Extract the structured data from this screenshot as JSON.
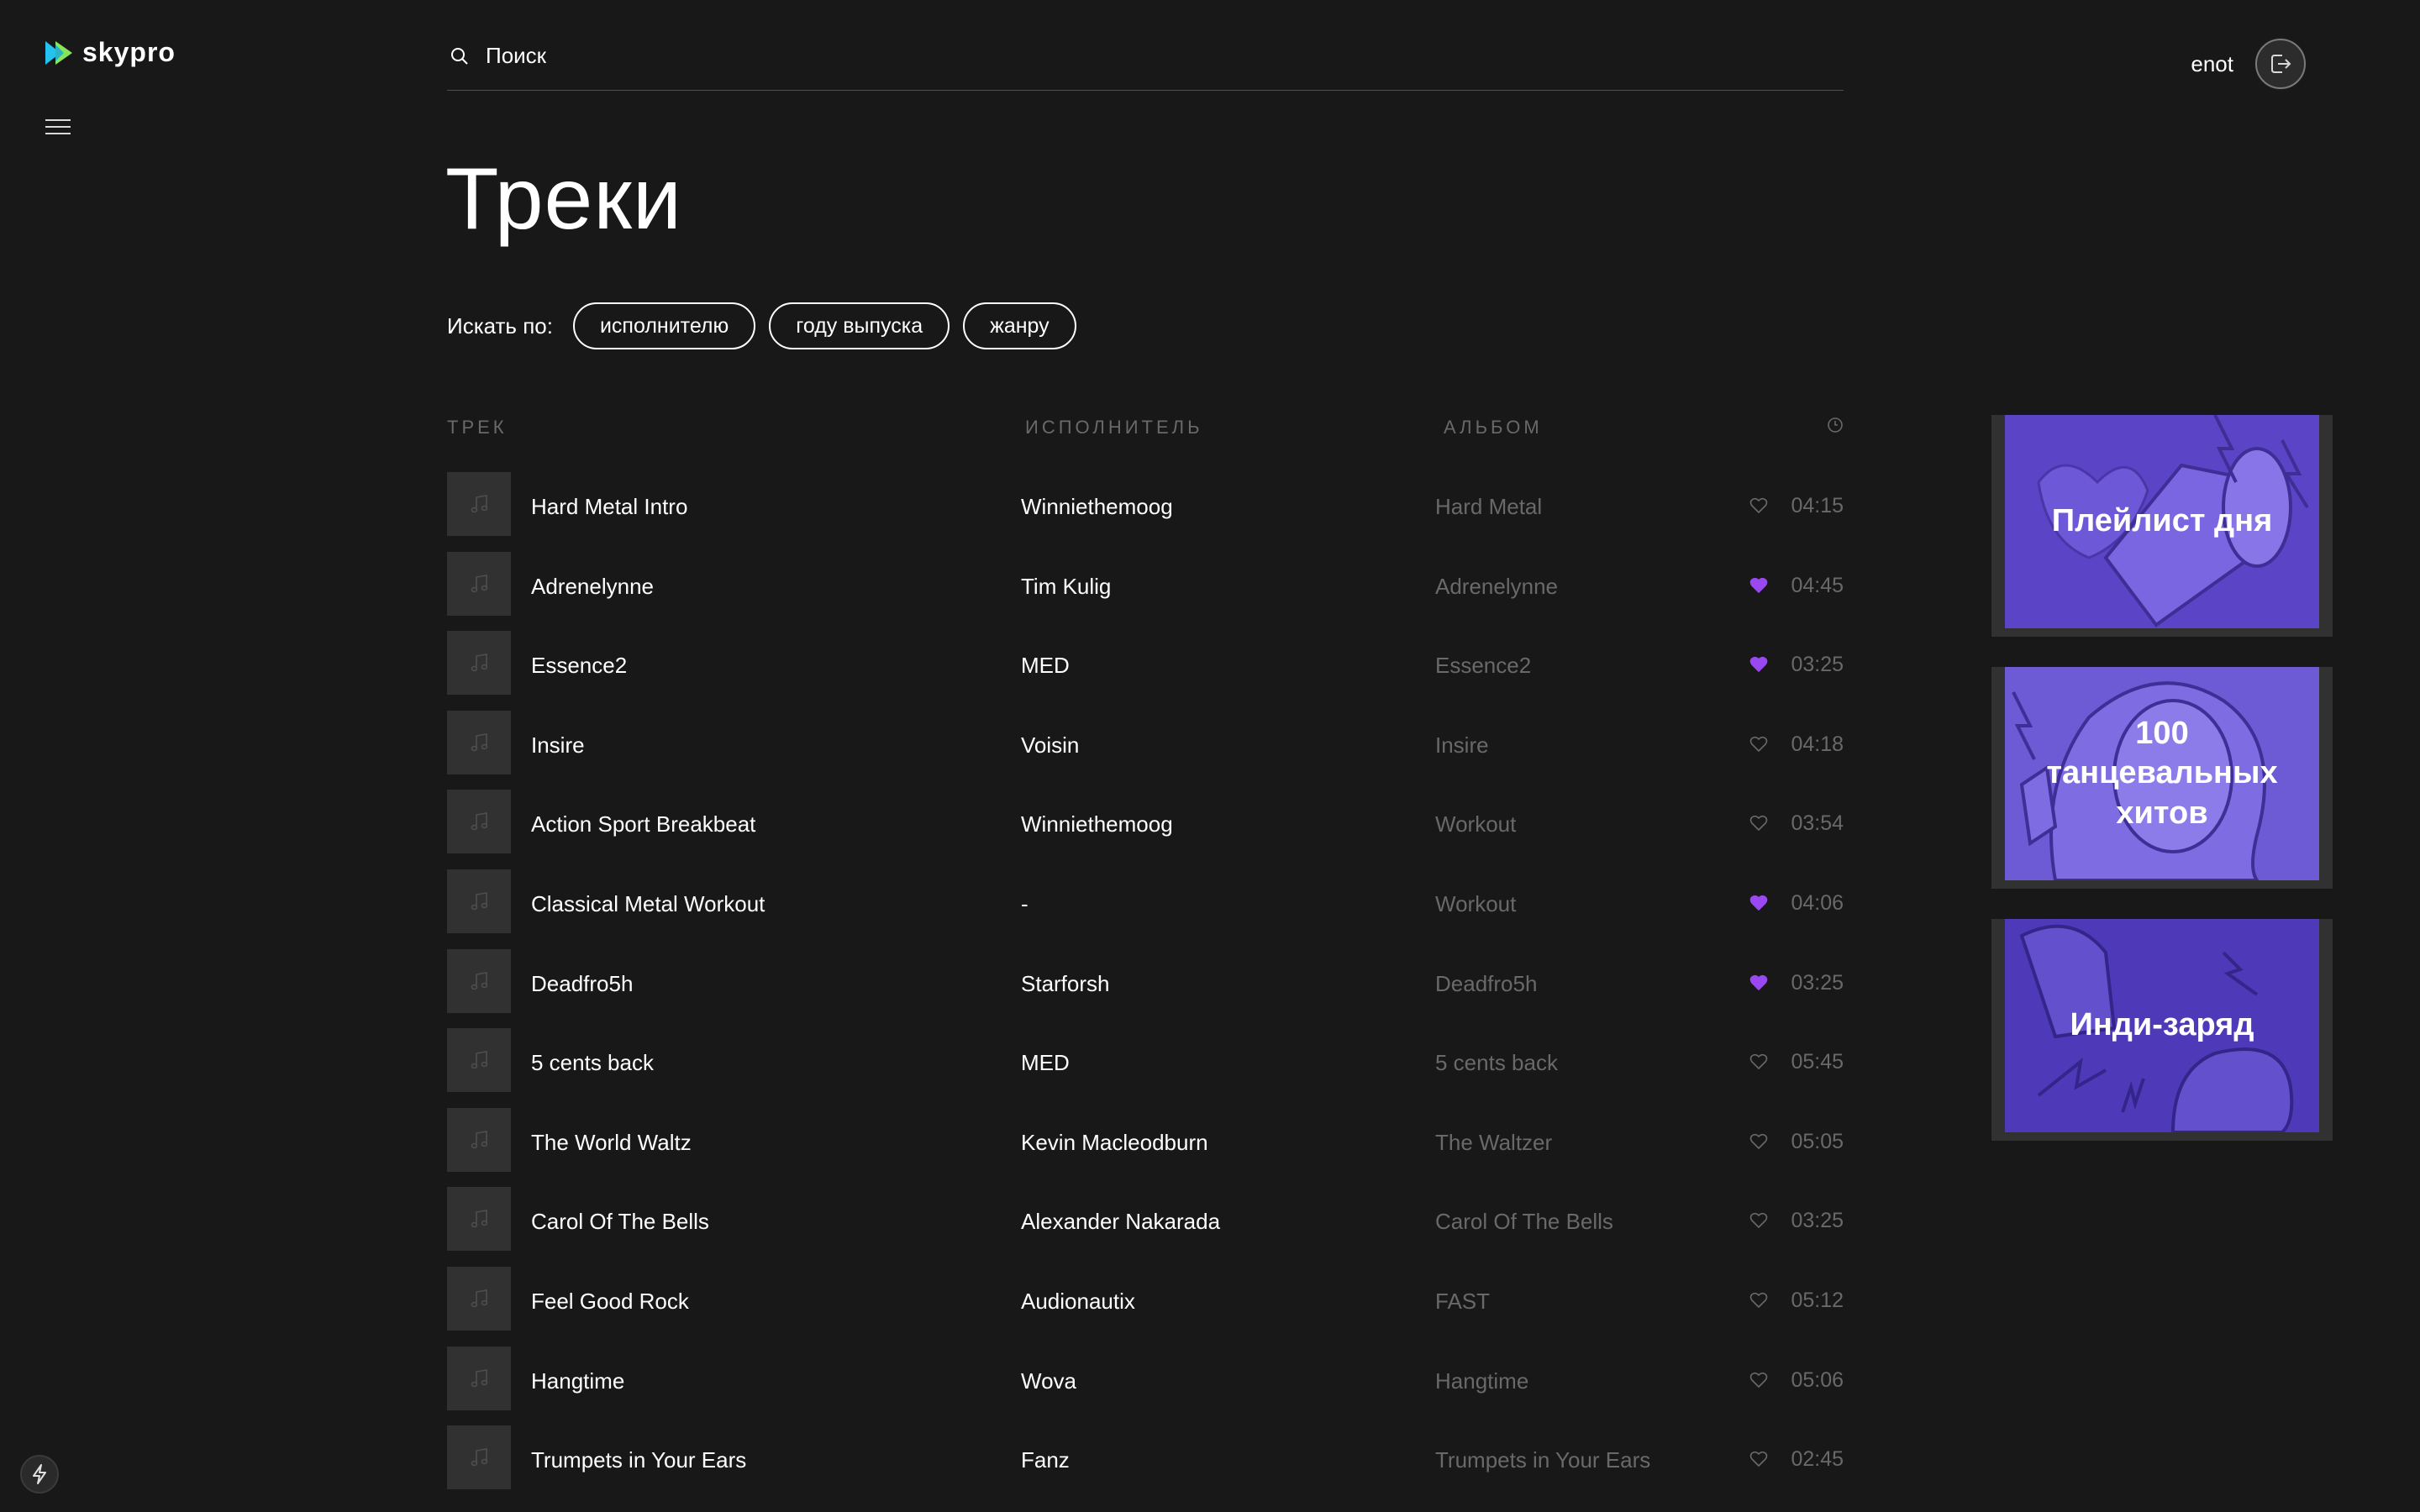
{
  "brand": {
    "name": "skypro"
  },
  "search": {
    "placeholder": "Поиск"
  },
  "user": {
    "name": "enot"
  },
  "page": {
    "title": "Треки"
  },
  "filters": {
    "label": "Искать по:",
    "buttons": [
      "исполнителю",
      "году выпуска",
      "жанру"
    ]
  },
  "table": {
    "headers": {
      "track": "ТРЕК",
      "artist": "ИСПОЛНИТЕЛЬ",
      "album": "АЛЬБОМ",
      "duration_icon": "clock-icon"
    },
    "rows": [
      {
        "title": "Hard Metal Intro",
        "artist": "Winniethemoog",
        "album": "Hard Metal",
        "liked": false,
        "time": "04:15"
      },
      {
        "title": "Adrenelynne",
        "artist": "Tim Kulig",
        "album": "Adrenelynne",
        "liked": true,
        "time": "04:45"
      },
      {
        "title": "Essence2",
        "artist": "MED",
        "album": "Essence2",
        "liked": true,
        "time": "03:25"
      },
      {
        "title": "Insire",
        "artist": "Voisin",
        "album": "Insire",
        "liked": false,
        "time": "04:18"
      },
      {
        "title": "Action Sport Breakbeat",
        "artist": "Winniethemoog",
        "album": "Workout",
        "liked": false,
        "time": "03:54"
      },
      {
        "title": "Classical Metal Workout",
        "artist": "-",
        "album": "Workout",
        "liked": true,
        "time": "04:06"
      },
      {
        "title": "Deadfro5h",
        "artist": "Starforsh",
        "album": "Deadfro5h",
        "liked": true,
        "time": "03:25"
      },
      {
        "title": "5 cents back",
        "artist": "MED",
        "album": "5 cents back",
        "liked": false,
        "time": "05:45"
      },
      {
        "title": "The World Waltz",
        "artist": "Kevin Macleodburn",
        "album": "The Waltzer",
        "liked": false,
        "time": "05:05"
      },
      {
        "title": "Carol Of The Bells",
        "artist": "Alexander Nakarada",
        "album": "Carol Of The Bells",
        "liked": false,
        "time": "03:25"
      },
      {
        "title": "Feel Good Rock",
        "artist": "Audionautix",
        "album": "FAST",
        "liked": false,
        "time": "05:12"
      },
      {
        "title": "Hangtime",
        "artist": "Wova",
        "album": "Hangtime",
        "liked": false,
        "time": "05:06"
      },
      {
        "title": "Trumpets in Your Ears",
        "artist": "Fanz",
        "album": "Trumpets in Your Ears",
        "liked": false,
        "time": "02:45"
      }
    ]
  },
  "playlists": [
    {
      "title": "Плейлист дня"
    },
    {
      "title": "100 танцевальных хитов"
    },
    {
      "title": "Инди-заряд"
    }
  ],
  "colors": {
    "background": "#181818",
    "accent": "#9A48F1",
    "muted": "#696969",
    "thumb": "#313131",
    "card": "#6F5BD3"
  }
}
